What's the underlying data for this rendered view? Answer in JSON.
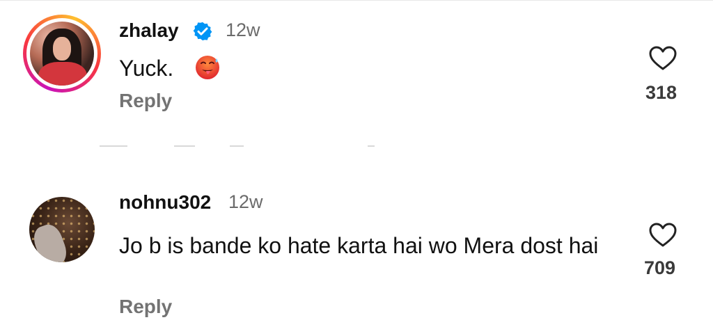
{
  "comments": [
    {
      "username": "zhalay",
      "verified": true,
      "time": "12w",
      "text": "Yuck.",
      "emoji": "hot-face-emoji",
      "reply_label": "Reply",
      "likes": "318",
      "avatar_has_story_ring": true
    },
    {
      "username": "nohnu302",
      "verified": false,
      "time": "12w",
      "text": "Jo b is bande ko hate karta hai wo Mera dost hai",
      "reply_label": "Reply",
      "likes": "709",
      "avatar_has_story_ring": false
    }
  ],
  "colors": {
    "verified_blue": "#0095f6",
    "secondary_text": "#737373",
    "story_ring": [
      "#c913b9",
      "#f9373f",
      "#fec02f"
    ]
  },
  "icons": {
    "verified": "verified-badge-icon",
    "like": "heart-icon"
  }
}
